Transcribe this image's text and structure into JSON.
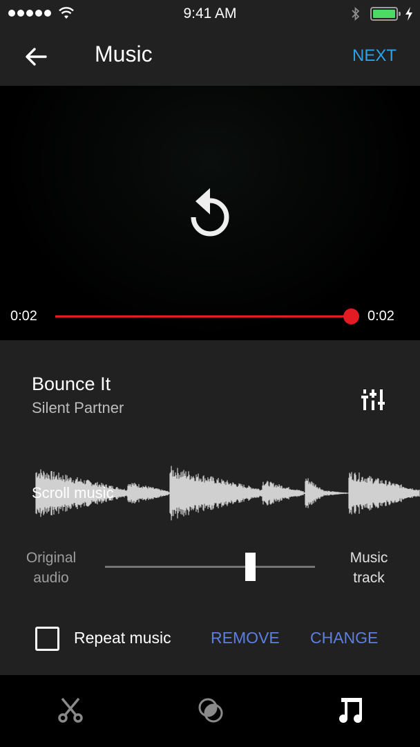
{
  "status_bar": {
    "time": "9:41 AM",
    "signal_bars": 5,
    "battery_percent": 100,
    "charging": true,
    "bluetooth": true
  },
  "app_bar": {
    "title": "Music",
    "back_icon": "arrow-left-icon",
    "next_label": "NEXT",
    "next_color": "#2aa3e8"
  },
  "player": {
    "current_time": "0:02",
    "total_time": "0:02",
    "progress": 1.0,
    "progress_color": "#e31b23",
    "center_icon": "replay-icon"
  },
  "track": {
    "title": "Bounce It",
    "artist": "Silent Partner",
    "settings_icon": "equalizer-icon"
  },
  "waveform": {
    "overlay_label": "Scroll music"
  },
  "mix": {
    "left_label_line1": "Original",
    "left_label_line2": "audio",
    "right_label_line1": "Music",
    "right_label_line2": "track",
    "level": 0.69
  },
  "actions": {
    "repeat_label": "Repeat music",
    "repeat_checked": false,
    "remove_label": "REMOVE",
    "change_label": "CHANGE",
    "action_color": "#5c7fe0"
  },
  "bottom_nav": {
    "items": [
      {
        "name": "trim",
        "icon": "scissors-icon",
        "active": false
      },
      {
        "name": "filters",
        "icon": "filters-icon",
        "active": false
      },
      {
        "name": "music",
        "icon": "music-note-icon",
        "active": true
      }
    ]
  }
}
